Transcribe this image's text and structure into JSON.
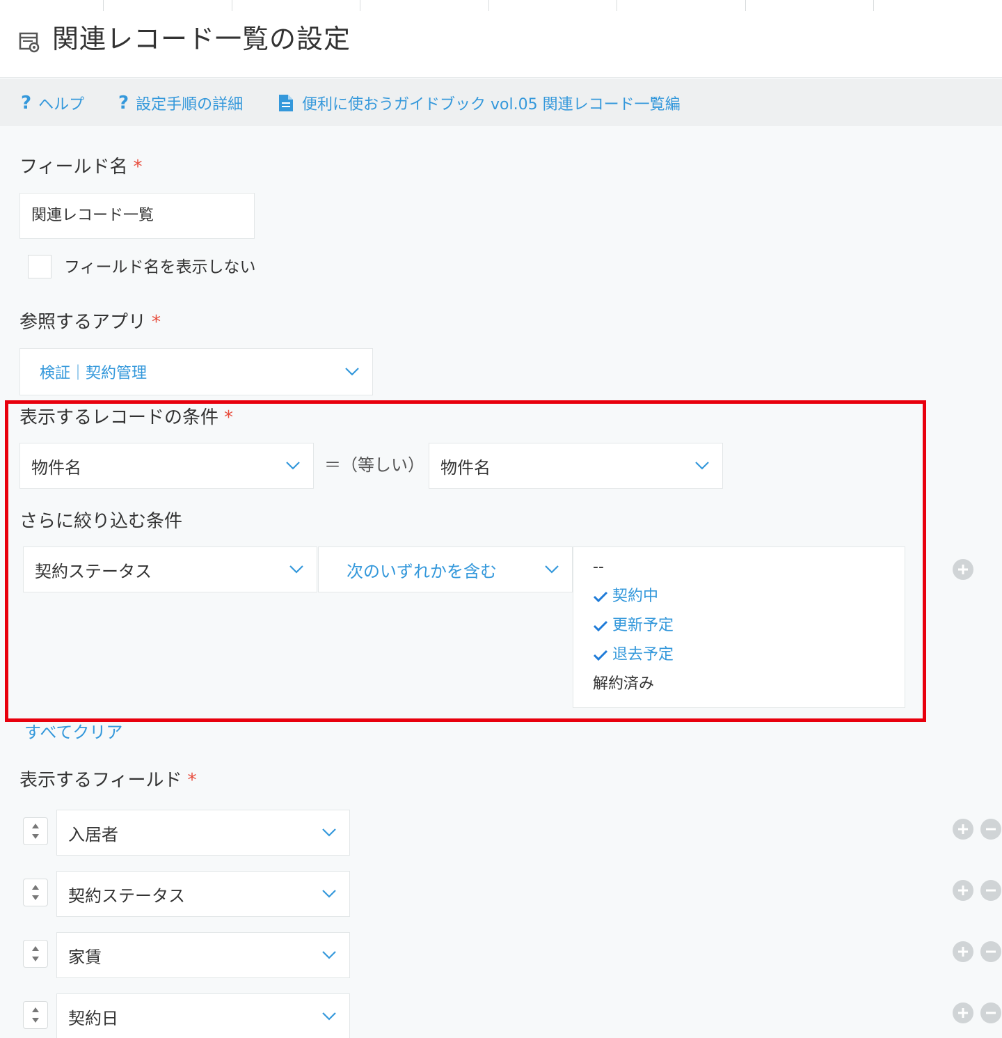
{
  "header": {
    "title": "関連レコード一覧の設定"
  },
  "help": {
    "help_label": "ヘルプ",
    "steps_label": "設定手順の詳細",
    "guide_label": "便利に使おうガイドブック vol.05 関連レコード一覧編"
  },
  "field_name": {
    "label": "フィールド名",
    "required_mark": "*",
    "value": "関連レコード一覧",
    "hide_label": "フィールド名を表示しない"
  },
  "ref_app": {
    "label": "参照するアプリ",
    "required_mark": "*",
    "value": "検証｜契約管理"
  },
  "condition": {
    "label": "表示するレコードの条件",
    "required_mark": "*",
    "left_field": "物件名",
    "operator": "＝（等しい）",
    "right_field": "物件名"
  },
  "filter": {
    "label": "さらに絞り込む条件",
    "field": "契約ステータス",
    "operator": "次のいずれかを含む",
    "options": [
      {
        "label": "--",
        "selected": false
      },
      {
        "label": "契約中",
        "selected": true
      },
      {
        "label": "更新予定",
        "selected": true
      },
      {
        "label": "退去予定",
        "selected": true
      },
      {
        "label": "解約済み",
        "selected": false
      }
    ],
    "clear_label": "すべてクリア"
  },
  "display_fields": {
    "label": "表示するフィールド",
    "required_mark": "*",
    "items": [
      "入居者",
      "契約ステータス",
      "家賃",
      "契約日"
    ]
  },
  "colors": {
    "accent": "#3498db",
    "required": "#e74c3c",
    "highlight": "#e8000d"
  }
}
